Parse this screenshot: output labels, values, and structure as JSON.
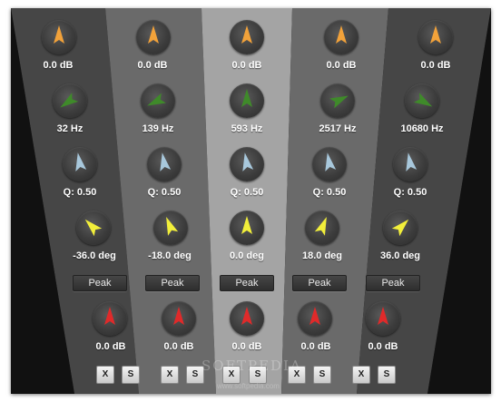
{
  "bands": [
    {
      "gain": "0.0 dB",
      "freq": "32 Hz",
      "q": "Q: 0.50",
      "slope": "-36.0 deg",
      "type": "Peak",
      "out_gain": "0.0 dB",
      "x_label": "X",
      "s_label": "S",
      "gain_knob_angle": 0,
      "freq_knob_angle": -125,
      "q_knob_angle": -10,
      "slope_knob_angle": -45,
      "out_knob_angle": 0
    },
    {
      "gain": "0.0 dB",
      "freq": "139 Hz",
      "q": "Q: 0.50",
      "slope": "-18.0 deg",
      "type": "Peak",
      "out_gain": "0.0 dB",
      "x_label": "X",
      "s_label": "S",
      "gain_knob_angle": 0,
      "freq_knob_angle": -115,
      "q_knob_angle": -10,
      "slope_knob_angle": -22,
      "out_knob_angle": 0
    },
    {
      "gain": "0.0 dB",
      "freq": "593 Hz",
      "q": "Q: 0.50",
      "slope": "0.0 deg",
      "type": "Peak",
      "out_gain": "0.0 dB",
      "x_label": "X",
      "s_label": "S",
      "gain_knob_angle": 0,
      "freq_knob_angle": 0,
      "q_knob_angle": -10,
      "slope_knob_angle": 0,
      "out_knob_angle": 0
    },
    {
      "gain": "0.0 dB",
      "freq": "2517 Hz",
      "q": "Q: 0.50",
      "slope": "18.0 deg",
      "type": "Peak",
      "out_gain": "0.0 dB",
      "x_label": "X",
      "s_label": "S",
      "gain_knob_angle": 0,
      "freq_knob_angle": 65,
      "q_knob_angle": -10,
      "slope_knob_angle": 22,
      "out_knob_angle": 0
    },
    {
      "gain": "0.0 dB",
      "freq": "10680 Hz",
      "q": "Q: 0.50",
      "slope": "36.0 deg",
      "type": "Peak",
      "out_gain": "0.0 dB",
      "x_label": "X",
      "s_label": "S",
      "gain_knob_angle": 0,
      "freq_knob_angle": 120,
      "q_knob_angle": -10,
      "slope_knob_angle": 45,
      "out_knob_angle": 0
    }
  ],
  "colors": {
    "gain_knob": "#f2a23a",
    "freq_knob": "#3f8a2a",
    "q_knob": "#a8c8dc",
    "slope_knob": "#f2ef3a",
    "out_knob": "#e02a2a"
  },
  "watermark": "SOFTPEDIA",
  "watermark_url": "www.softpedia.com"
}
